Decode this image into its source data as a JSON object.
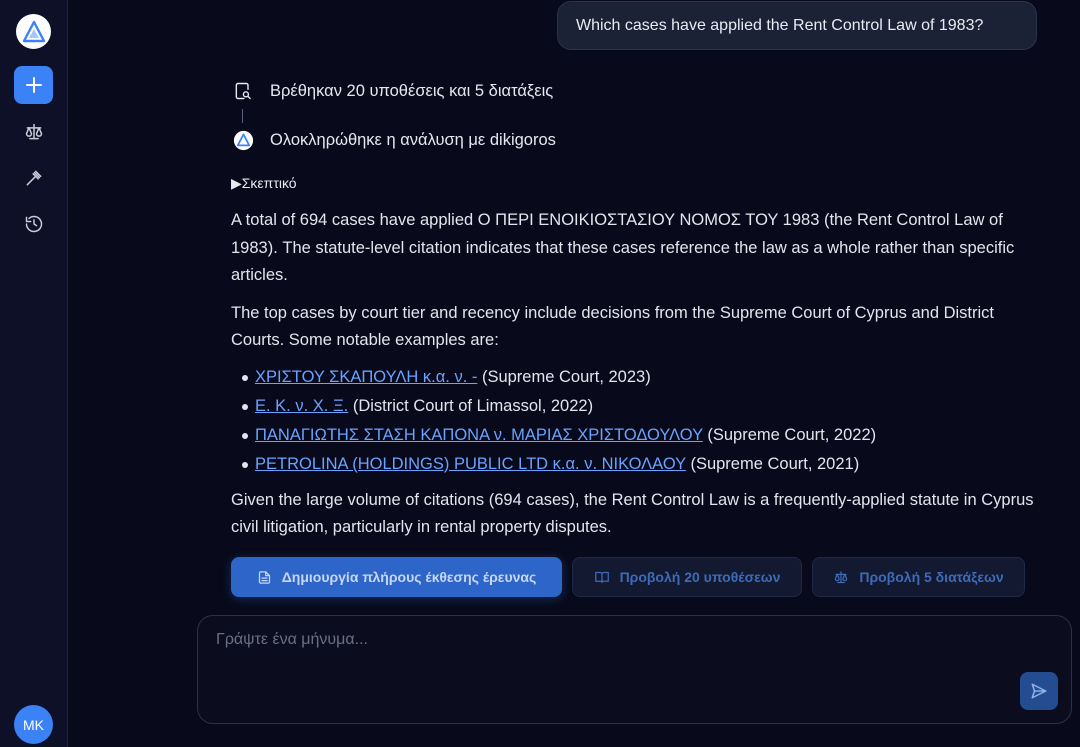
{
  "sidebar": {
    "logo_icon": "triangle-logo-icon",
    "new_chat_icon": "plus-icon",
    "items": [
      {
        "icon": "scales-icon"
      },
      {
        "icon": "gavel-icon"
      },
      {
        "icon": "history-icon"
      }
    ],
    "avatar_initials": "MK"
  },
  "user_message": "Which cases have applied the Rent Control Law of 1983?",
  "steps": [
    {
      "icon": "document-search-icon",
      "text": "Βρέθηκαν 20 υποθέσεις και 5 διατάξεις"
    },
    {
      "icon": "triangle-logo-icon",
      "text": "Ολοκληρώθηκε η ανάλυση με dikigoros"
    }
  ],
  "thinking_toggle": "Σκεπτικό",
  "answer": {
    "p1": "A total of 694 cases have applied Ο ΠΕΡΙ ΕΝΟΙΚΙΟΣΤΑΣΙΟΥ ΝΟΜΟΣ ΤΟΥ 1983 (the Rent Control Law of 1983). The statute-level citation indicates that these cases reference the law as a whole rather than specific articles.",
    "p2": "The top cases by court tier and recency include decisions from the Supreme Court of Cyprus and District Courts. Some notable examples are:",
    "cases": [
      {
        "link": "ΧΡΙΣΤΟΥ ΣΚΑΠΟΥΛΗ κ.α. ν. -",
        "detail": " (Supreme Court, 2023)"
      },
      {
        "link": "Ε. Κ. ν. Χ. Ξ.",
        "detail": " (District Court of Limassol, 2022)"
      },
      {
        "link": "ΠΑΝΑΓΙΩΤΗΣ ΣΤΑΣΗ ΚΑΠΟΝΑ ν. ΜΑΡΙΑΣ ΧΡΙΣΤΟΔΟΥΛΟΥ",
        "detail": " (Supreme Court, 2022)"
      },
      {
        "link": "PETROLINA (HOLDINGS) PUBLIC LTD κ.α. ν. ΝΙΚΟΛΑΟΥ",
        "detail": " (Supreme Court, 2021)"
      }
    ],
    "p3": "Given the large volume of citations (694 cases), the Rent Control Law is a frequently-applied statute in Cyprus civil litigation, particularly in rental property disputes."
  },
  "actions": {
    "report": "Δημιουργία πλήρους έκθεσης έρευνας",
    "cases": "Προβολή 20 υποθέσεων",
    "provisions": "Προβολή 5 διατάξεων"
  },
  "composer": {
    "placeholder": "Γράψτε ένα μήνυμα...",
    "value": ""
  },
  "colors": {
    "accent": "#3b82f6",
    "link": "#6aa2ff",
    "background": "#080a1b"
  }
}
